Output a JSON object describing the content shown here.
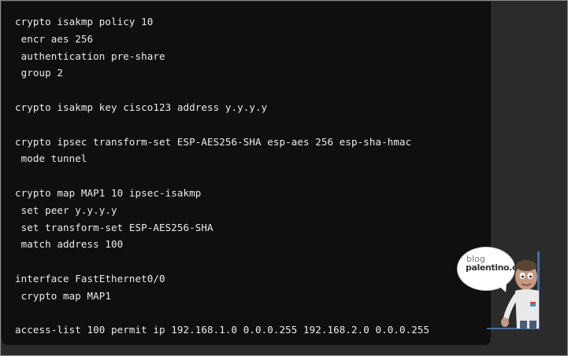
{
  "code": {
    "blocks": [
      [
        "crypto isakmp policy 10",
        " encr aes 256",
        " authentication pre-share",
        " group 2"
      ],
      [
        "crypto isakmp key cisco123 address y.y.y.y"
      ],
      [
        "crypto ipsec transform-set ESP-AES256-SHA esp-aes 256 esp-sha-hmac",
        " mode tunnel"
      ],
      [
        "crypto map MAP1 10 ipsec-isakmp",
        " set peer y.y.y.y",
        " set transform-set ESP-AES256-SHA",
        " match address 100"
      ],
      [
        "interface FastEthernet0/0",
        " crypto map MAP1"
      ],
      [
        "access-list 100 permit ip 192.168.1.0 0.0.0.255 192.168.2.0 0.0.0.255"
      ]
    ]
  },
  "mascot": {
    "line1": "blog",
    "line2": "palentino.es",
    "icon": "cartoon-character-icon"
  },
  "colors": {
    "page_background": "#2b2b2b",
    "code_background": "#0f0f0f",
    "code_text": "#ececec"
  }
}
